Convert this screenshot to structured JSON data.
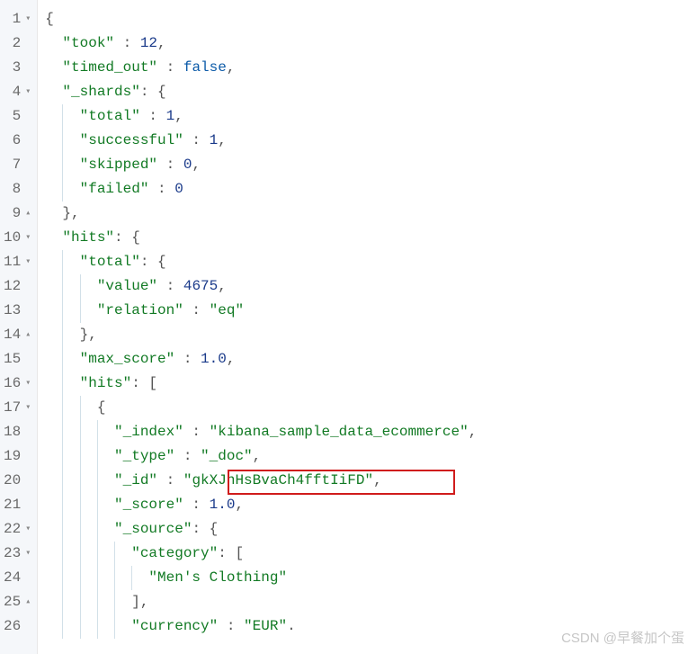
{
  "watermark": "CSDN @早餐加个蛋",
  "gutter": [
    {
      "n": "1",
      "fold": "▾"
    },
    {
      "n": "2",
      "fold": ""
    },
    {
      "n": "3",
      "fold": ""
    },
    {
      "n": "4",
      "fold": "▾"
    },
    {
      "n": "5",
      "fold": ""
    },
    {
      "n": "6",
      "fold": ""
    },
    {
      "n": "7",
      "fold": ""
    },
    {
      "n": "8",
      "fold": ""
    },
    {
      "n": "9",
      "fold": "▴"
    },
    {
      "n": "10",
      "fold": "▾"
    },
    {
      "n": "11",
      "fold": "▾"
    },
    {
      "n": "12",
      "fold": ""
    },
    {
      "n": "13",
      "fold": ""
    },
    {
      "n": "14",
      "fold": "▴"
    },
    {
      "n": "15",
      "fold": ""
    },
    {
      "n": "16",
      "fold": "▾"
    },
    {
      "n": "17",
      "fold": "▾"
    },
    {
      "n": "18",
      "fold": ""
    },
    {
      "n": "19",
      "fold": ""
    },
    {
      "n": "20",
      "fold": ""
    },
    {
      "n": "21",
      "fold": ""
    },
    {
      "n": "22",
      "fold": "▾"
    },
    {
      "n": "23",
      "fold": "▾"
    },
    {
      "n": "24",
      "fold": ""
    },
    {
      "n": "25",
      "fold": "▴"
    },
    {
      "n": "26",
      "fold": ""
    }
  ],
  "code": {
    "l1": {
      "p": "{"
    },
    "l2": {
      "k": "\"took\"",
      "v": "12"
    },
    "l3": {
      "k": "\"timed_out\"",
      "v": "false"
    },
    "l4": {
      "k": "\"_shards\"",
      "p": ": {"
    },
    "l5": {
      "k": "\"total\"",
      "v": "1"
    },
    "l6": {
      "k": "\"successful\"",
      "v": "1"
    },
    "l7": {
      "k": "\"skipped\"",
      "v": "0"
    },
    "l8": {
      "k": "\"failed\"",
      "v": "0"
    },
    "l9": {
      "p": "},"
    },
    "l10": {
      "k": "\"hits\"",
      "p": ": {"
    },
    "l11": {
      "k": "\"total\"",
      "p": ": {"
    },
    "l12": {
      "k": "\"value\"",
      "v": "4675"
    },
    "l13": {
      "k": "\"relation\"",
      "v": "\"eq\""
    },
    "l14": {
      "p": "},"
    },
    "l15": {
      "k": "\"max_score\"",
      "v": "1.0"
    },
    "l16": {
      "k": "\"hits\"",
      "p": ": ["
    },
    "l17": {
      "p": "{"
    },
    "l18": {
      "k": "\"_index\"",
      "v": "\"kibana_sample_data_ecommerce\""
    },
    "l19": {
      "k": "\"_type\"",
      "v": "\"_doc\""
    },
    "l20": {
      "k": "\"_id\"",
      "v": "\"gkXJhHsBvaCh4fftIiFD\""
    },
    "l21": {
      "k": "\"_score\"",
      "v": "1.0"
    },
    "l22": {
      "k": "\"_source\"",
      "p": ": {"
    },
    "l23": {
      "k": "\"category\"",
      "p": ": ["
    },
    "l24": {
      "v": "\"Men's Clothing\""
    },
    "l25": {
      "p": "],"
    },
    "l26": {
      "k": "\"currency\"",
      "v": "\"EUR\""
    }
  },
  "chart_data": {
    "type": "table",
    "title": "Elasticsearch JSON response",
    "json": {
      "took": 12,
      "timed_out": false,
      "_shards": {
        "total": 1,
        "successful": 1,
        "skipped": 0,
        "failed": 0
      },
      "hits": {
        "total": {
          "value": 4675,
          "relation": "eq"
        },
        "max_score": 1.0,
        "hits": [
          {
            "_index": "kibana_sample_data_ecommerce",
            "_type": "_doc",
            "_id": "gkXJhHsBvaCh4fftIiFD",
            "_score": 1.0,
            "_source": {
              "category": [
                "Men's Clothing"
              ],
              "currency": "EUR"
            }
          }
        ]
      }
    }
  }
}
